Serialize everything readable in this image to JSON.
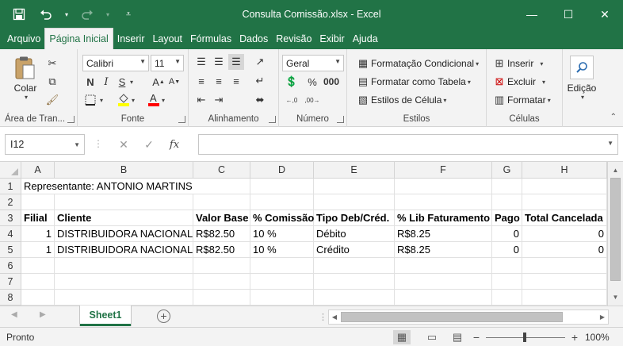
{
  "window": {
    "title": "Consulta Comissão.xlsx - Excel",
    "qat": {
      "save_icon": "save-icon",
      "undo_icon": "undo-icon",
      "redo_icon": "redo-icon",
      "customize_icon": "customize-qat-icon"
    },
    "controls": {
      "minimize": "minimize-icon",
      "maximize": "maximize-icon",
      "close": "close-icon"
    }
  },
  "tabs": [
    "Arquivo",
    "Página Inicial",
    "Inserir",
    "Layout",
    "Fórmulas",
    "Dados",
    "Revisão",
    "Exibir",
    "Ajuda"
  ],
  "active_tab": "Página Inicial",
  "ribbon": {
    "clipboard": {
      "paste_label": "Colar",
      "group_label": "Área de Tran..."
    },
    "font": {
      "font_name": "Calibri",
      "font_size": "11",
      "bold": "N",
      "italic": "I",
      "underline": "S",
      "group_label": "Fonte",
      "fill_color": "#FFFF00",
      "font_color": "#FF0000"
    },
    "alignment": {
      "group_label": "Alinhamento"
    },
    "number": {
      "format": "Geral",
      "group_label": "Número"
    },
    "styles": {
      "conditional": "Formatação Condicional",
      "table": "Formatar como Tabela",
      "cell": "Estilos de Célula",
      "group_label": "Estilos"
    },
    "cells": {
      "insert": "Inserir",
      "delete": "Excluir",
      "format": "Formatar",
      "group_label": "Células"
    },
    "editing": {
      "label": "Edição"
    }
  },
  "formula_bar": {
    "name_box": "I12",
    "formula": ""
  },
  "grid": {
    "columns": [
      "A",
      "B",
      "C",
      "D",
      "E",
      "F",
      "G",
      "H"
    ],
    "rows": [
      "1",
      "2",
      "3",
      "4",
      "5",
      "6",
      "7",
      "8"
    ],
    "r1": {
      "a": "Representante: ANTONIO MARTINS"
    },
    "headers": {
      "a": "Filial",
      "b": "Cliente",
      "c": "Valor Base",
      "d": "% Comissão",
      "e": "Tipo Deb/Créd.",
      "f": "% Lib Faturamento",
      "g": "Pago",
      "h": "Total Cancelada"
    },
    "data": [
      {
        "a": "1",
        "b": "DISTRIBUIDORA NACIONAL",
        "c": "R$82.50",
        "d": "10 %",
        "e": "Débito",
        "f": "R$8.25",
        "g": "0",
        "h": "0"
      },
      {
        "a": "1",
        "b": "DISTRIBUIDORA NACIONAL",
        "c": "R$82.50",
        "d": "10 %",
        "e": "Crédito",
        "f": "R$8.25",
        "g": "0",
        "h": "0"
      }
    ]
  },
  "sheets": {
    "active": "Sheet1"
  },
  "status": {
    "text": "Pronto",
    "zoom": "100%"
  },
  "accent_color": "#217346"
}
